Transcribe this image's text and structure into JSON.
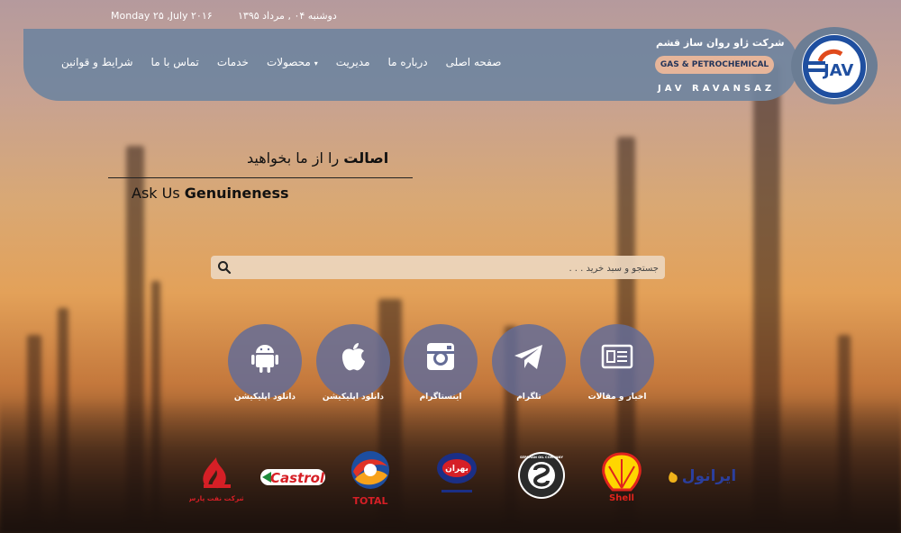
{
  "dates": {
    "gregorian": "Monday ۲۵ ,July ۲۰۱۶",
    "persian": "دوشنبه ۰۴ , مرداد ۱۳۹۵"
  },
  "header": {
    "company_name": "شرکت ژاو روان ساز قشم",
    "badge": "GAS & PETROCHEMICAL",
    "brand_latin": "JAV RAVANSAZ",
    "logo_text": "JAV",
    "nav": [
      "صفحه اصلی",
      "درباره ما",
      "مدیریت",
      "محصولات",
      "خدمات",
      "تماس با ما",
      "شرایط و قوانین"
    ]
  },
  "tagline": {
    "fa_bold": "اصالت",
    "fa_rest": " را از ما بخواهید",
    "en_prefix": "Ask Us ",
    "en_bold": "Genuineness"
  },
  "search": {
    "placeholder": "جستجو و سبد خرید . . ."
  },
  "quick_links": [
    {
      "label": "دانلود اپلیکیشن",
      "icon": "android-icon"
    },
    {
      "label": "دانلود اپلیکیشن",
      "icon": "apple-icon"
    },
    {
      "label": "اینستاگرام",
      "icon": "instagram-icon"
    },
    {
      "label": "تلگرام",
      "icon": "telegram-icon"
    },
    {
      "label": "اخبار و مقالات",
      "icon": "news-icon"
    }
  ],
  "brands": {
    "pars": "شرکت نفت پارس",
    "castrol": "Castrol",
    "total": "TOTAL",
    "behran": "بهران",
    "sepahan": "SEPAHAN OIL COMPANY",
    "shell": "Shell",
    "iranol": "ایرانول"
  },
  "colors": {
    "header": "#70849e",
    "badge": "#e6b59a",
    "circle": "#646c96"
  }
}
